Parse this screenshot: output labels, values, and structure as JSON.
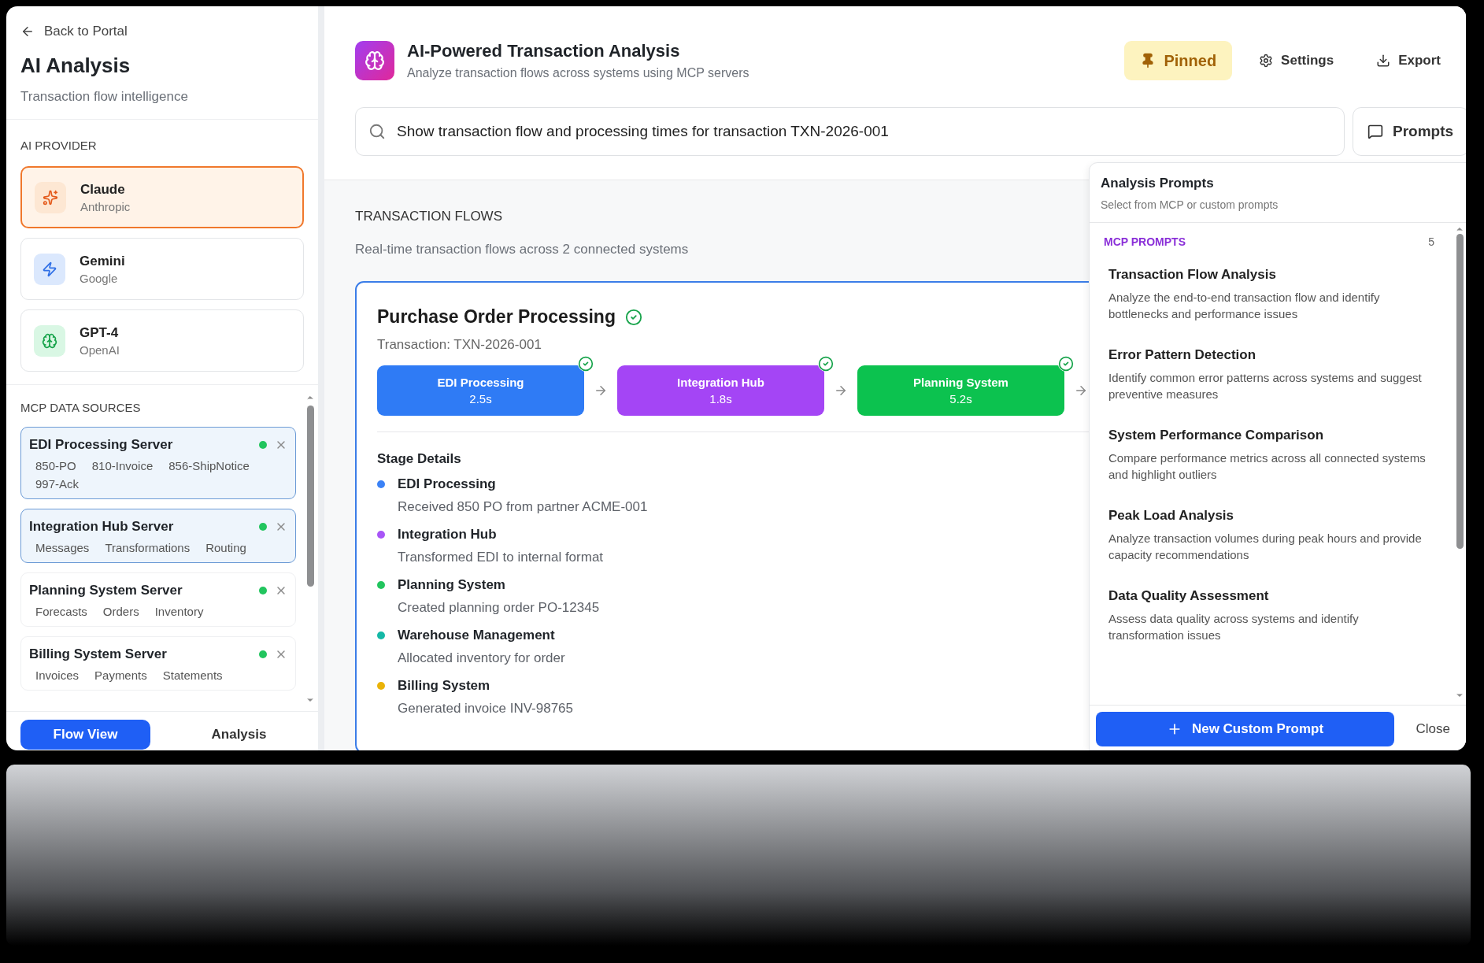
{
  "sidebar": {
    "back_link": "Back to Portal",
    "title": "AI Analysis",
    "subtitle": "Transaction flow intelligence",
    "provider_heading": "AI PROVIDER",
    "providers": [
      {
        "name": "Claude",
        "vendor": "Anthropic",
        "kind": "claude",
        "selected": true
      },
      {
        "name": "Gemini",
        "vendor": "Google",
        "kind": "gemini",
        "selected": false
      },
      {
        "name": "GPT-4",
        "vendor": "OpenAI",
        "kind": "gpt",
        "selected": false
      }
    ],
    "sources_heading": "MCP DATA SOURCES",
    "servers": [
      {
        "name": "EDI Processing Server",
        "connected": true,
        "selected": true,
        "tags": [
          "850-PO",
          "810-Invoice",
          "856-ShipNotice",
          "997-Ack"
        ]
      },
      {
        "name": "Integration Hub Server",
        "connected": true,
        "selected": true,
        "tags": [
          "Messages",
          "Transformations",
          "Routing"
        ]
      },
      {
        "name": "Planning System Server",
        "connected": true,
        "selected": false,
        "tags": [
          "Forecasts",
          "Orders",
          "Inventory"
        ]
      },
      {
        "name": "Billing System Server",
        "connected": true,
        "selected": false,
        "tags": [
          "Invoices",
          "Payments",
          "Statements"
        ]
      }
    ],
    "view_tabs": [
      {
        "label": "Flow View",
        "selected": true
      },
      {
        "label": "Analysis",
        "selected": false
      }
    ]
  },
  "header": {
    "title": "AI-Powered Transaction Analysis",
    "subtitle": "Analyze transaction flows across systems using MCP servers",
    "actions": [
      {
        "label": "Pinned",
        "kind": "pin",
        "active": true
      },
      {
        "label": "Settings",
        "kind": "settings",
        "active": false
      },
      {
        "label": "Export",
        "kind": "export",
        "active": false
      }
    ]
  },
  "query": {
    "value": "Show transaction flow and processing times for transaction TXN-2026-001"
  },
  "prompts_button": {
    "label": "Prompts"
  },
  "flows": {
    "heading": "TRANSACTION FLOWS",
    "subtitle": "Real-time transaction flows across 2 connected systems",
    "card": {
      "title": "Purchase Order Processing",
      "completed": true,
      "transaction": "Transaction: TXN-2026-001",
      "stages": [
        {
          "name": "EDI Processing",
          "duration": "2.5s",
          "color": "#2f7bf5",
          "done": true
        },
        {
          "name": "Integration Hub",
          "duration": "1.8s",
          "color": "#a445f5",
          "done": true
        },
        {
          "name": "Planning System",
          "duration": "5.2s",
          "color": "#0cc24f",
          "done": true
        }
      ],
      "details_heading": "Stage Details",
      "details": [
        {
          "name": "EDI Processing",
          "description": "Received 850 PO from partner ACME-001",
          "color": "#3b82f6"
        },
        {
          "name": "Integration Hub",
          "description": "Transformed EDI to internal format",
          "color": "#a855f7"
        },
        {
          "name": "Planning System",
          "description": "Created planning order PO-12345",
          "color": "#22c55e"
        },
        {
          "name": "Warehouse Management",
          "description": "Allocated inventory for order",
          "color": "#14b8a6"
        },
        {
          "name": "Billing System",
          "description": "Generated invoice INV-98765",
          "color": "#eab308"
        }
      ]
    }
  },
  "prompts_panel": {
    "title": "Analysis Prompts",
    "subtitle": "Select from MCP or custom prompts",
    "section_label": "MCP PROMPTS",
    "section_count": "5",
    "items": [
      {
        "title": "Transaction Flow Analysis",
        "description": "Analyze the end-to-end transaction flow and identify bottlenecks and performance issues"
      },
      {
        "title": "Error Pattern Detection",
        "description": "Identify common error patterns across systems and suggest preventive measures"
      },
      {
        "title": "System Performance Comparison",
        "description": "Compare performance metrics across all connected systems and highlight outliers"
      },
      {
        "title": "Peak Load Analysis",
        "description": "Analyze transaction volumes during peak hours and provide capacity recommendations"
      },
      {
        "title": "Data Quality Assessment",
        "description": "Assess data quality across systems and identify transformation issues"
      }
    ],
    "new_button": "New Custom Prompt",
    "close": "Close"
  }
}
